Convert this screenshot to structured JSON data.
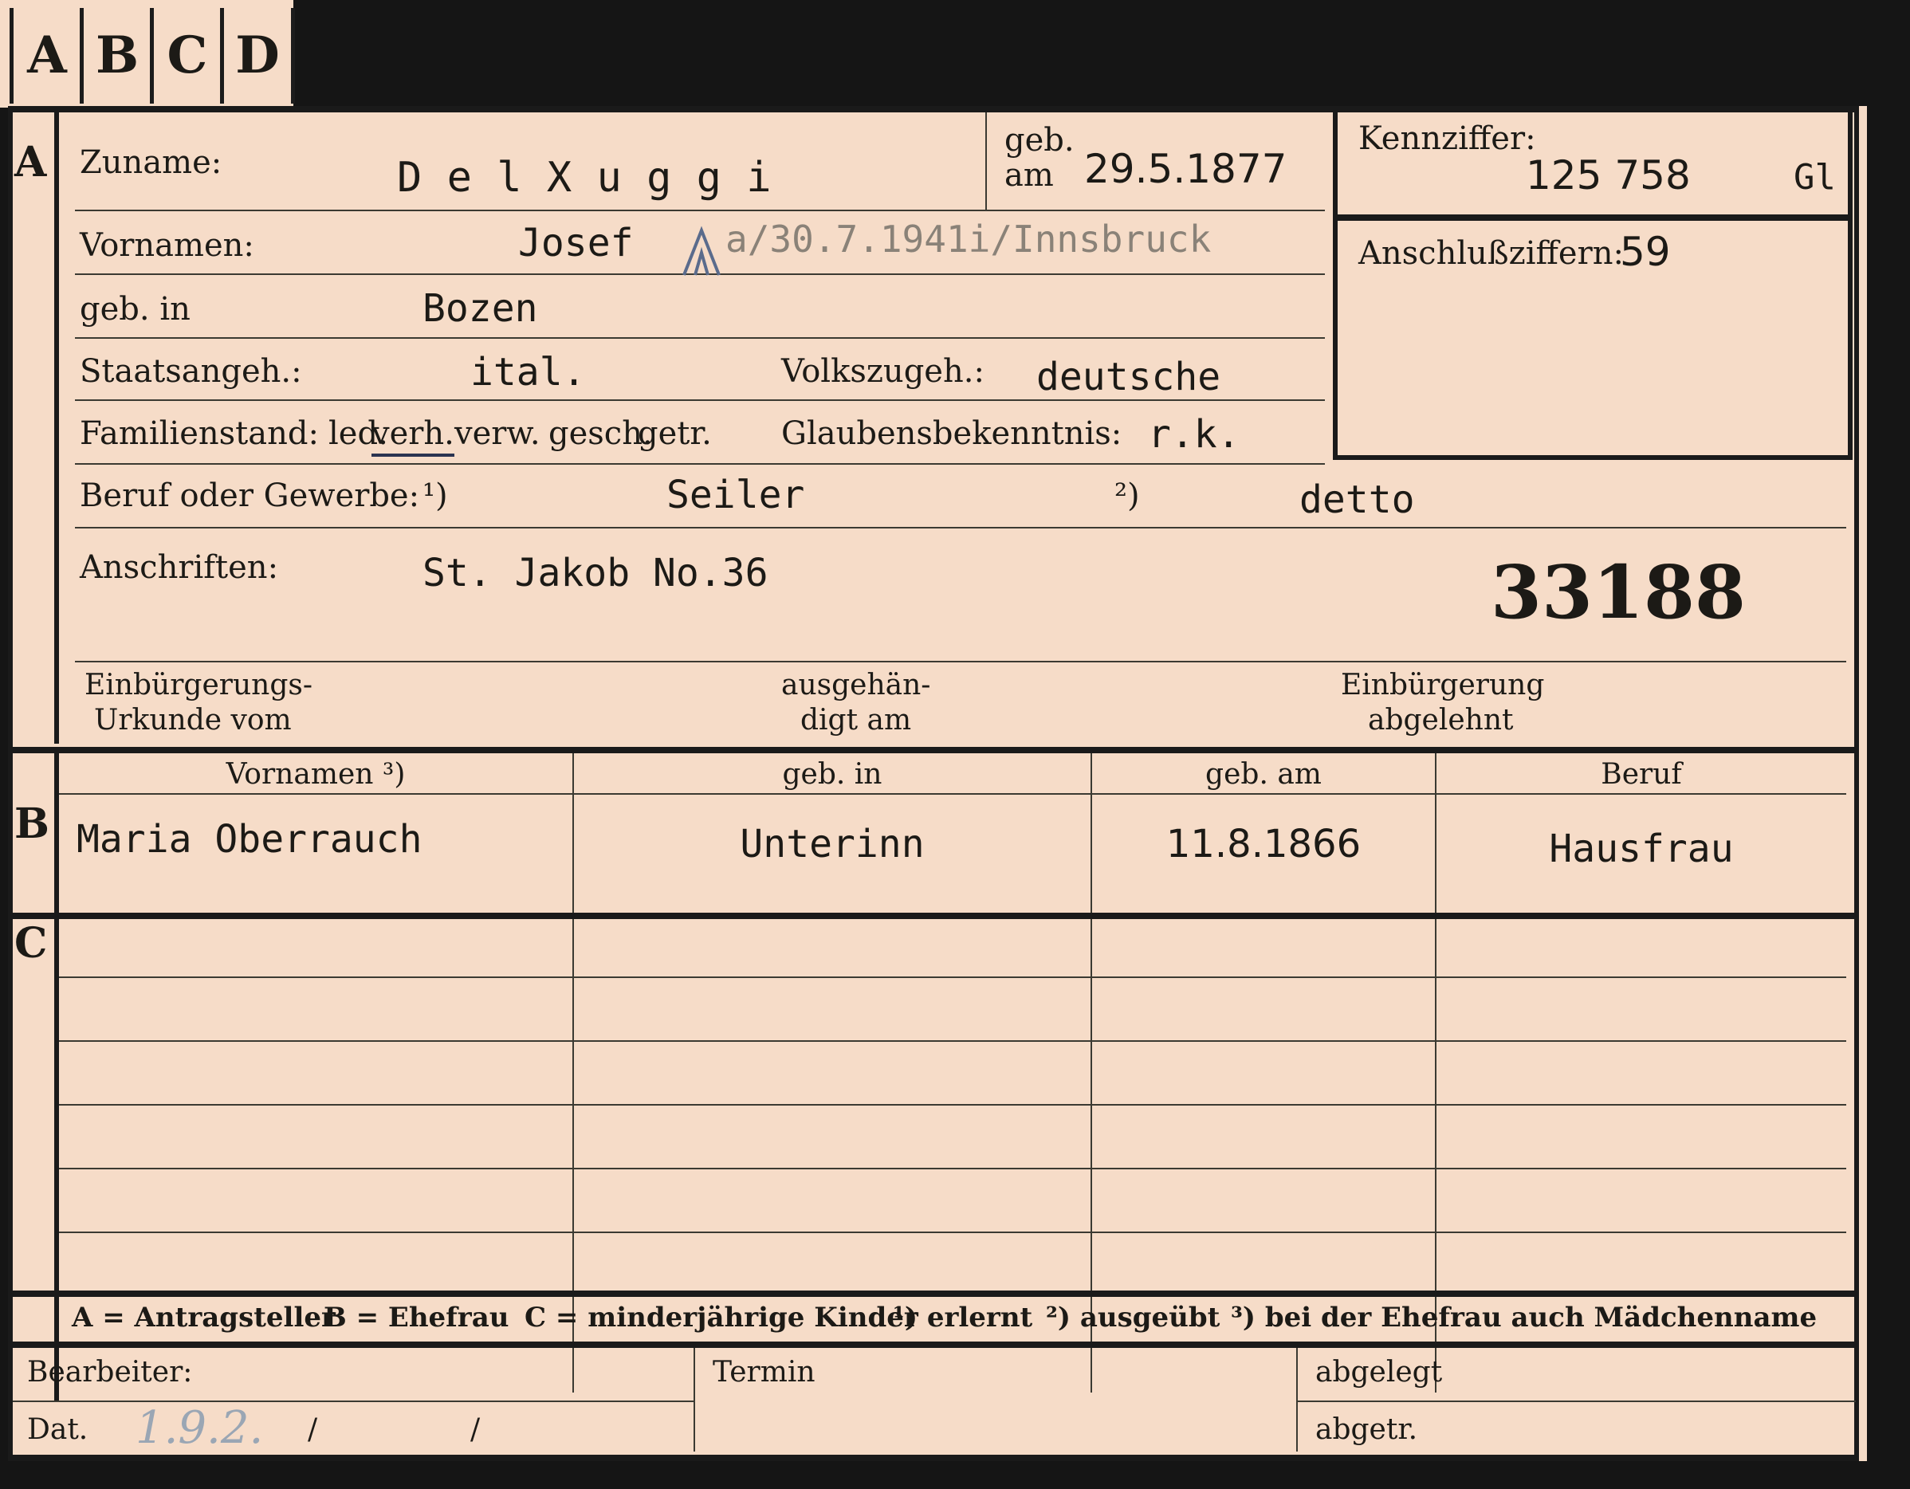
{
  "tabs": [
    "A",
    "B",
    "C",
    "D"
  ],
  "section_a": {
    "letter": "A",
    "surname_label": "Zuname:",
    "surname_value": "D e l X u g g i",
    "geb_am_label_1": "geb.",
    "geb_am_label_2": "am",
    "geb_am_value": "29.5.1877",
    "kennziffer_label": "Kennziffer:",
    "kennziffer_value": "125 758",
    "kennziffer_suffix": "Gl",
    "anschluss_label": "Anschlußziffern:",
    "anschluss_value": "59",
    "vornamen_label": "Vornamen:",
    "vornamen_value": "Josef",
    "vornamen_note": "a/30.7.1941i/Innsbruck",
    "geb_in_label": "geb. in",
    "geb_in_value": "Bozen",
    "staat_label": "Staatsangeh.:",
    "staat_value": "ital.",
    "volk_label": "Volkszugeh.:",
    "volk_value": "deutsche",
    "familien_label": "Familienstand:",
    "familien_options": [
      "led.",
      "verh.",
      "verw.",
      "gesch.",
      "getr."
    ],
    "glaube_label": "Glaubensbekenntnis:",
    "glaube_value": "r.k.",
    "beruf_label": "Beruf oder Gewerbe:",
    "beruf_mark_1": "¹)",
    "beruf_value_1": "Seiler",
    "beruf_mark_2": "²)",
    "beruf_value_2": "detto",
    "anschrift_label": "Anschriften:",
    "anschrift_value": "St. Jakob No.36",
    "stamp_number": "33188",
    "einb_label_1": "Einbürgerungs-",
    "einb_label_2": "Urkunde vom",
    "ausg_label_1": "ausgehän-",
    "ausg_label_2": "digt am",
    "abgel_label_1": "Einbürgerung",
    "abgel_label_2": "abgelehnt"
  },
  "section_b": {
    "letter": "B",
    "headers": [
      "Vornamen ³)",
      "geb. in",
      "geb. am",
      "Beruf"
    ],
    "row": [
      "Maria Oberrauch",
      "Unterinn",
      "11.8.1866",
      "Hausfrau"
    ]
  },
  "section_c": {
    "letter": "C"
  },
  "legend": {
    "a": "A = Antragsteller",
    "b": "B = Ehefrau",
    "c": "C = minderjährige Kinder",
    "n1": "¹) erlernt",
    "n2": "²) ausgeübt",
    "n3": "³) bei der Ehefrau auch Mädchenname"
  },
  "footer": {
    "bearbeiter_label": "Bearbeiter:",
    "dat_label": "Dat.",
    "dat_value": "1.9.2.",
    "slash": "/",
    "termin_label": "Termin",
    "abgelegt_label": "abgelegt",
    "abgetr_label": "abgetr."
  }
}
